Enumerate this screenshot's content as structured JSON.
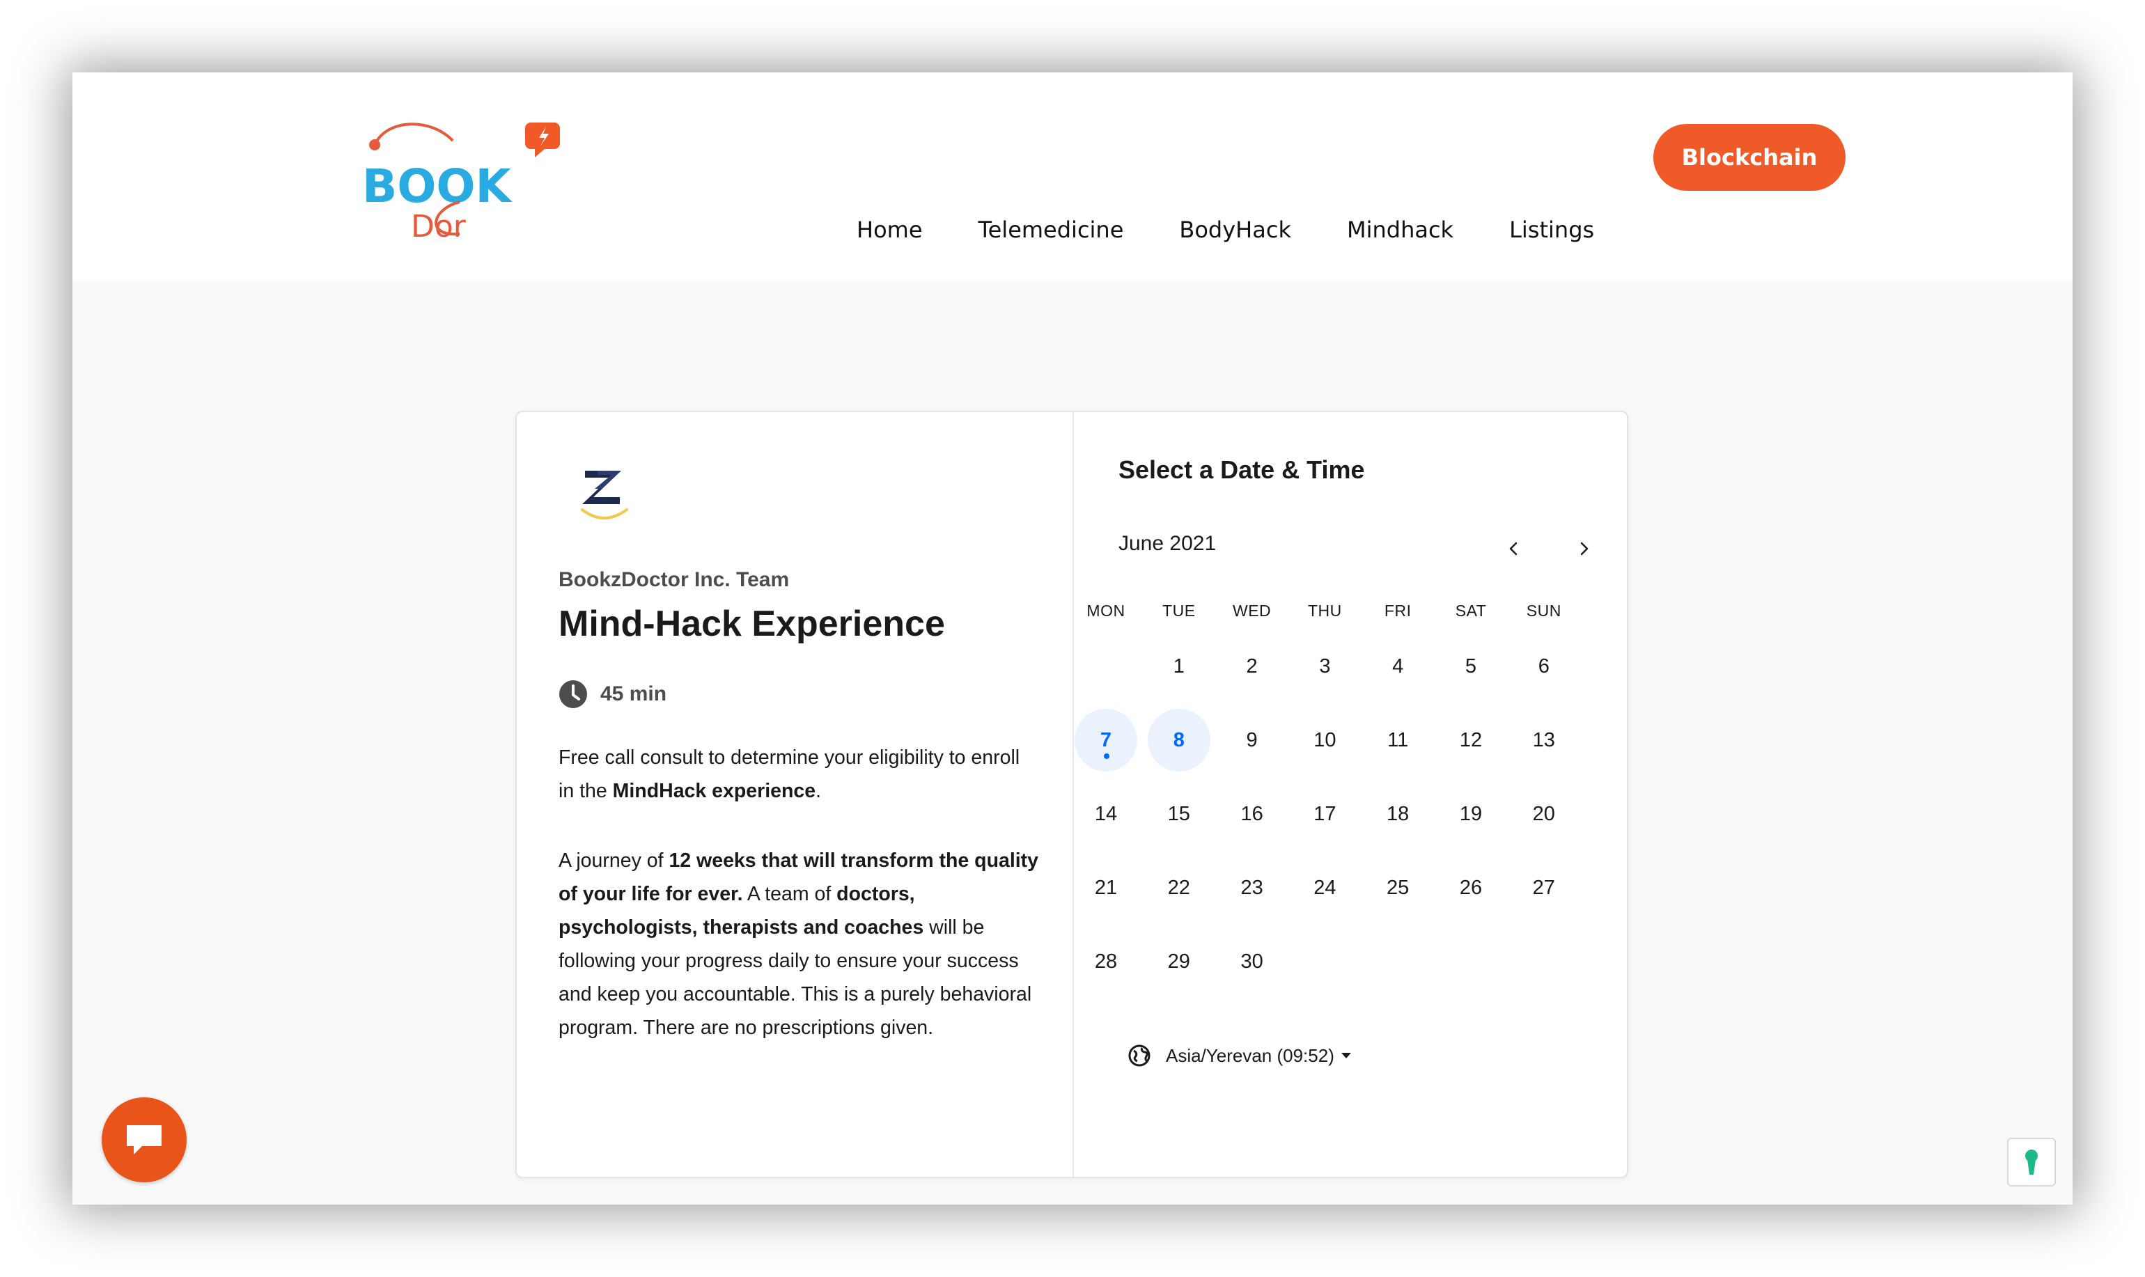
{
  "header": {
    "logo": {
      "line1": "BOOK",
      "line2": "Dor"
    },
    "nav": [
      "Home",
      "Telemedicine",
      "BodyHack",
      "Mindhack",
      "Listings"
    ],
    "cta_label": "Blockchain"
  },
  "event": {
    "org_name": "BookzDoctor Inc. Team",
    "title": "Mind-Hack Experience",
    "duration": "45 min",
    "description": {
      "p1_a": "Free call consult to determine your eligibility to enroll in the ",
      "p1_b": "MindHack experience",
      "p1_c": ".",
      "p2_a": "A journey of ",
      "p2_b": "12 weeks that will transform the quality of your life for ever.",
      "p2_c": " A team of ",
      "p2_d": "doctors, psychologists, therapists and coaches",
      "p2_e": " will be following your progress daily to ensure your success and keep you accountable. This is a purely behavioral program. There are no prescriptions given."
    }
  },
  "calendar": {
    "title": "Select a Date & Time",
    "month": "June 2021",
    "weekdays": [
      "MON",
      "TUE",
      "WED",
      "THU",
      "FRI",
      "SAT",
      "SUN"
    ],
    "first_weekday_index": 1,
    "days_in_month": 30,
    "available_days": [
      7,
      8
    ],
    "today": 7,
    "timezone": "Asia/Yerevan (09:52)"
  },
  "colors": {
    "brand_orange": "#f05a28",
    "available_bg": "#eaf2fe",
    "available_text": "#0069ff",
    "logo_blue": "#29abe2"
  }
}
